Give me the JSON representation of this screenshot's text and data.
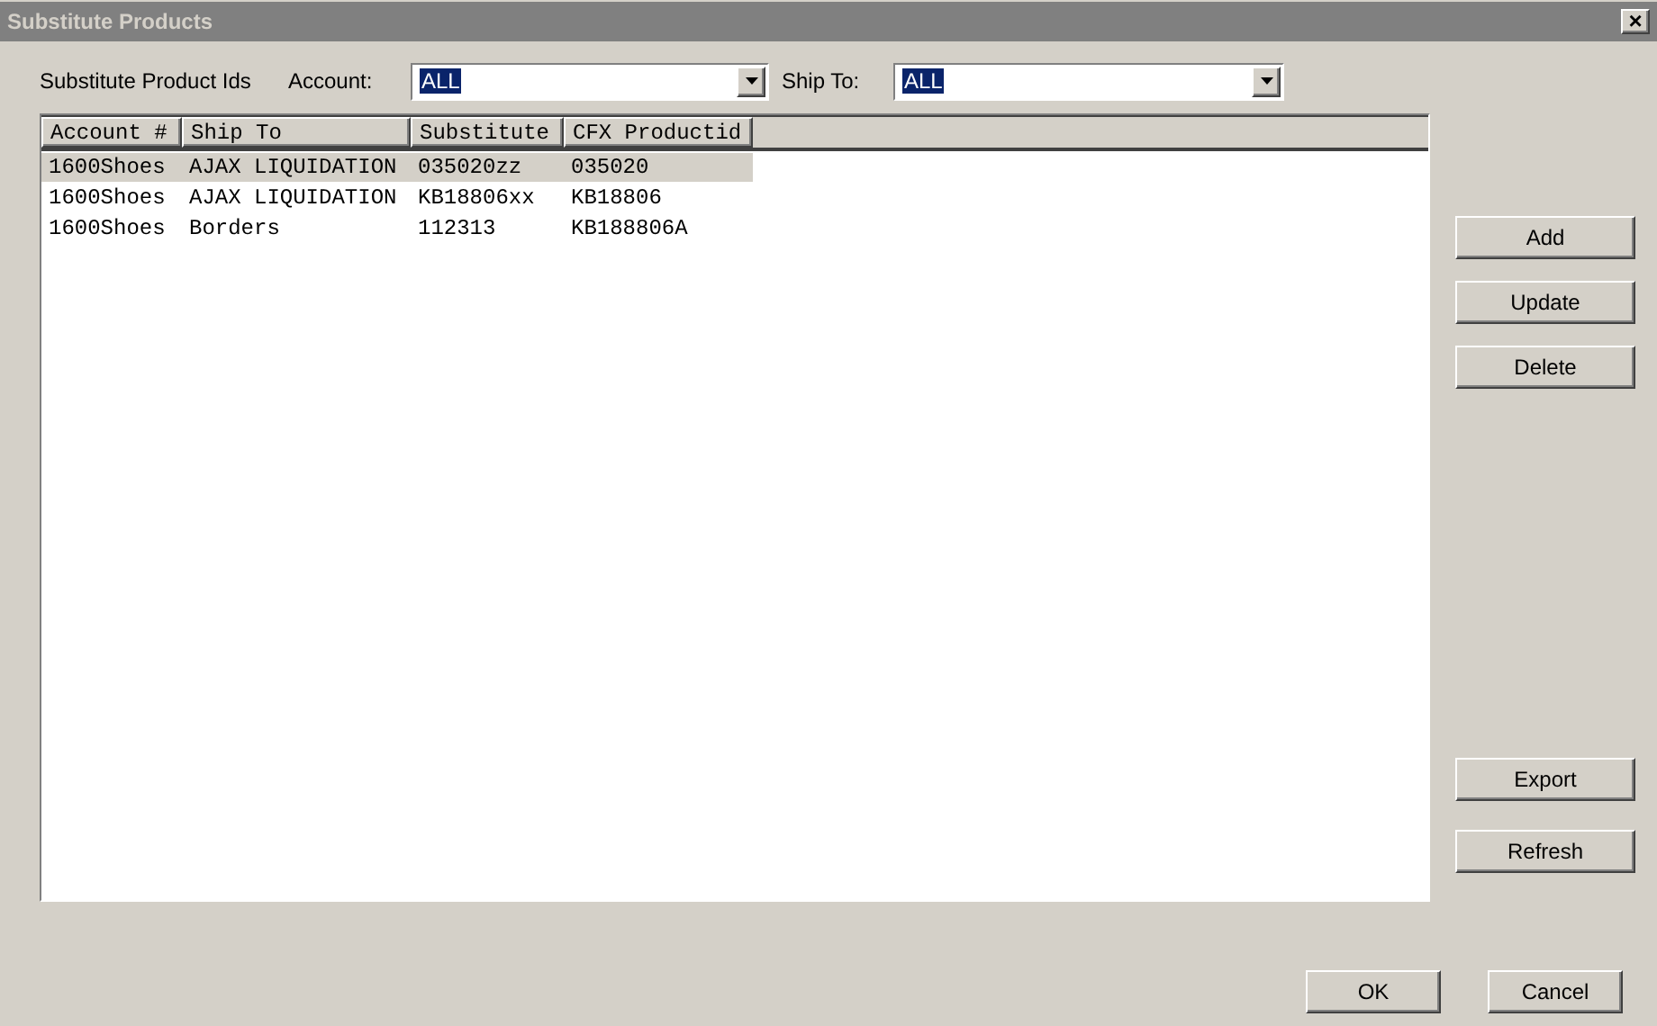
{
  "window": {
    "title": "Substitute Products",
    "close": "×"
  },
  "filters": {
    "title": "Substitute Product Ids",
    "account_label": "Account:",
    "account_value": "ALL",
    "ship_to_label": "Ship To:",
    "ship_to_value": "ALL"
  },
  "table": {
    "columns": [
      "Account #",
      "Ship To",
      "Substitute",
      "CFX Productid"
    ],
    "rows": [
      {
        "cells": [
          "1600Shoes",
          "AJAX LIQUIDATION",
          "035020zz",
          "035020"
        ],
        "selected": true
      },
      {
        "cells": [
          "1600Shoes",
          "AJAX LIQUIDATION",
          "KB18806xx",
          "KB18806"
        ],
        "selected": false
      },
      {
        "cells": [
          "1600Shoes",
          "Borders",
          "112313",
          "KB188806A"
        ],
        "selected": false
      }
    ]
  },
  "side_buttons": {
    "top": [
      "Add",
      "Update",
      "Delete"
    ],
    "bottom": [
      "Export",
      "Refresh"
    ]
  },
  "buttons": [
    "OK",
    "Cancel"
  ]
}
